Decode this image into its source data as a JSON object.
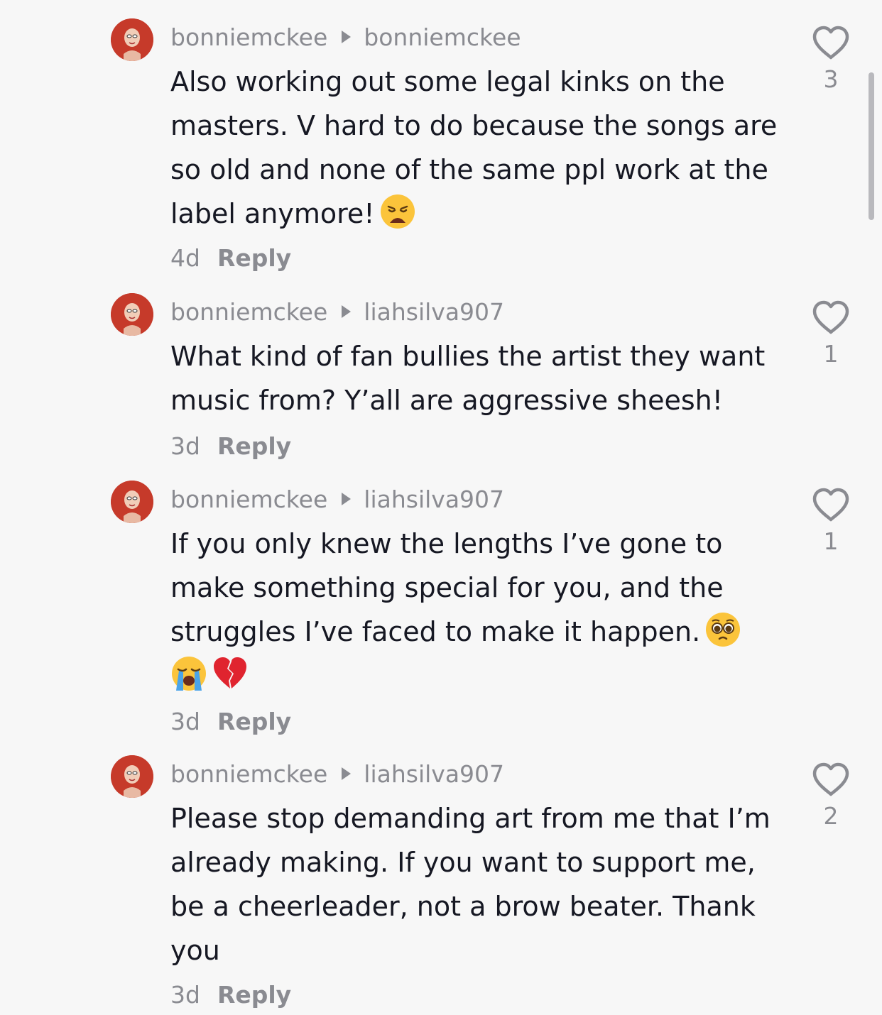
{
  "comments": [
    {
      "author": "bonniemckee",
      "reply_to": "bonniemckee",
      "text": "Also working out some legal kinks on the masters. V hard to do because the songs are so old and none of the same ppl work at the label anymore!",
      "emojis": [
        "weary-face-emoji"
      ],
      "time": "4d",
      "reply_label": "Reply",
      "likes": "3"
    },
    {
      "author": "bonniemckee",
      "reply_to": "liahsilva907",
      "text": "What kind of fan bullies the artist they want music from? Y’all are aggressive sheesh!",
      "emojis": [],
      "time": "3d",
      "reply_label": "Reply",
      "likes": "1"
    },
    {
      "author": "bonniemckee",
      "reply_to": "liahsilva907",
      "text": "If you only knew the lengths I’ve gone to make something special for you, and the struggles I’ve faced to make it happen.",
      "emojis": [
        "pleading-face-emoji",
        "loudly-crying-face-emoji",
        "broken-heart-emoji"
      ],
      "time": "3d",
      "reply_label": "Reply",
      "likes": "1"
    },
    {
      "author": "bonniemckee",
      "reply_to": "liahsilva907",
      "text": "Please stop demanding art from me that I’m already making. If you want to support me, be a cheerleader, not a brow beater. Thank you",
      "emojis": [],
      "time": "3d",
      "reply_label": "Reply",
      "likes": "2"
    }
  ],
  "icons": {
    "like": "heart-outline-icon",
    "reply_arrow": "triangle-right-icon"
  },
  "colors": {
    "background": "#f7f7f7",
    "text": "#161823",
    "secondary": "#8a8b91",
    "avatar_hair": "#c63a2a"
  }
}
